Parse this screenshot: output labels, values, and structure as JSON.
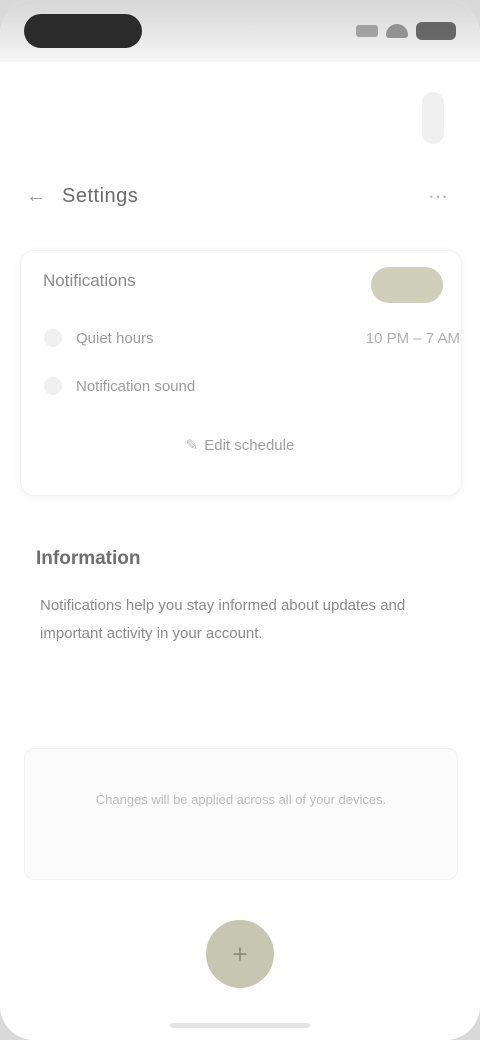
{
  "header": {
    "back_icon": "arrow-left-icon",
    "title": "Settings",
    "more_icon": "more-icon"
  },
  "card": {
    "title": "Notifications",
    "toggle_on": true,
    "accent_color": "#cfcfbc",
    "rows": [
      {
        "label": "Quiet hours",
        "value": "10 PM – 7 AM"
      },
      {
        "label": "Notification sound",
        "value": ""
      }
    ],
    "link_label": "Edit schedule"
  },
  "section": {
    "title": "Information",
    "body": "Notifications help you stay informed about updates and important activity in your account."
  },
  "note": {
    "text": "Changes will be applied across all of your devices."
  },
  "fab": {
    "icon": "add-icon",
    "color": "#c6c6b2"
  }
}
